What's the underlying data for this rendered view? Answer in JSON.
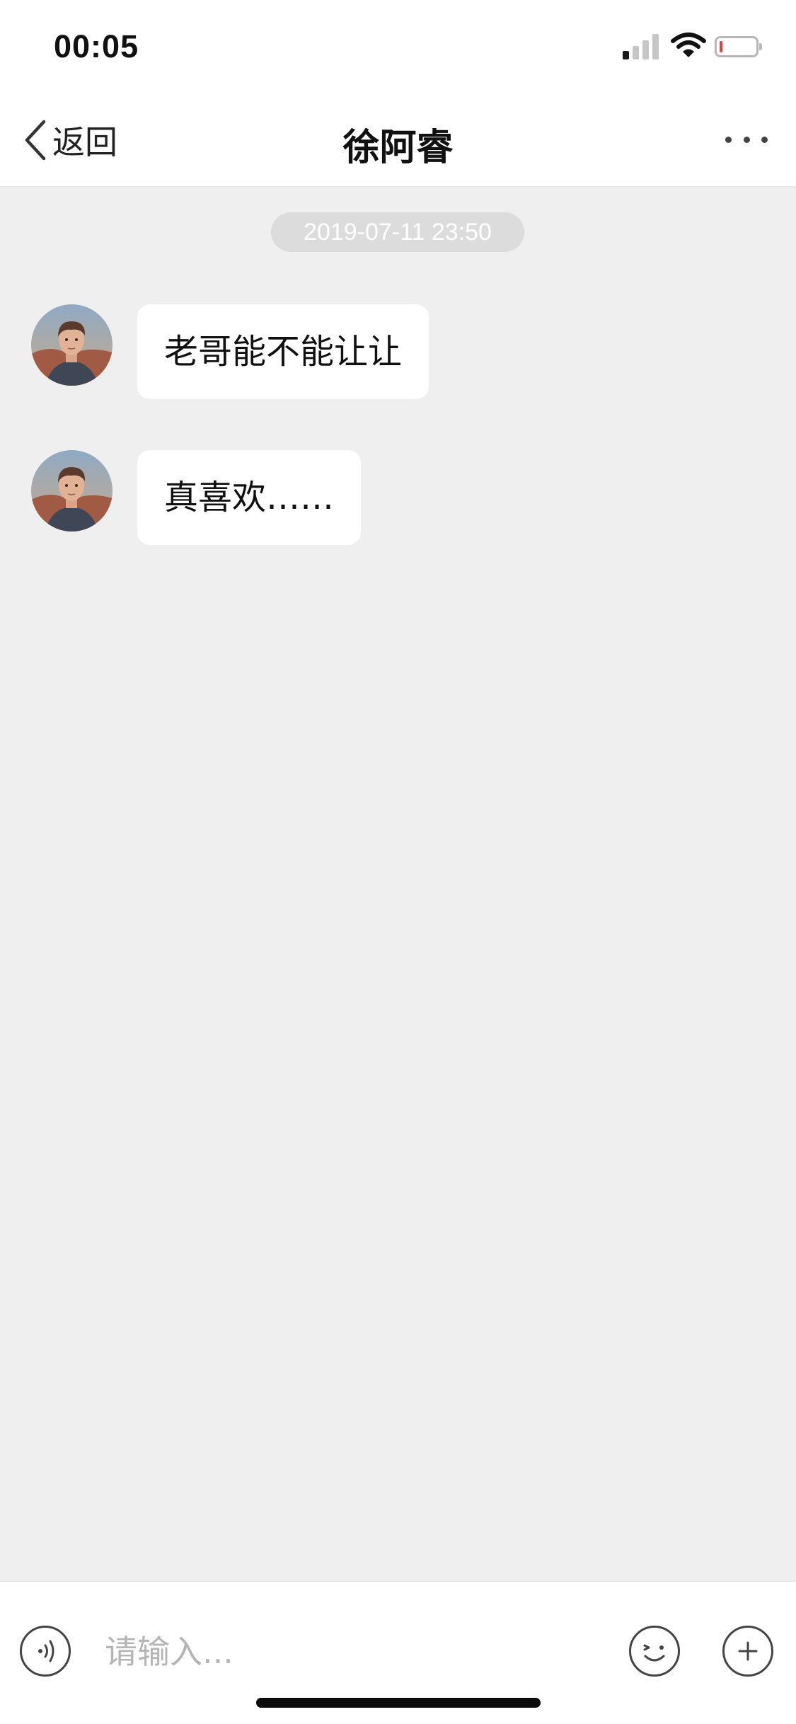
{
  "status_bar": {
    "time": "00:05",
    "icons": [
      "cellular-signal-icon",
      "wifi-icon",
      "battery-low-icon"
    ]
  },
  "nav": {
    "back_label": "返回",
    "title": "徐阿睿",
    "more_icon": "more-dots-icon"
  },
  "chat": {
    "timestamp": "2019-07-11 23:50",
    "messages": [
      {
        "sender": "contact",
        "text": "老哥能不能让让"
      },
      {
        "sender": "contact",
        "text": "真喜欢……"
      }
    ]
  },
  "input_bar": {
    "placeholder": "请输入...",
    "value": "",
    "voice_icon": "voice-icon",
    "emoji_icon": "emoji-icon",
    "add_icon": "plus-icon"
  },
  "colors": {
    "chat_background": "#efefef",
    "bar_background": "#ffffff",
    "bubble_background": "#ffffff",
    "timestamp_pill": "#dcdcdc",
    "battery_low": "#e2403a"
  }
}
